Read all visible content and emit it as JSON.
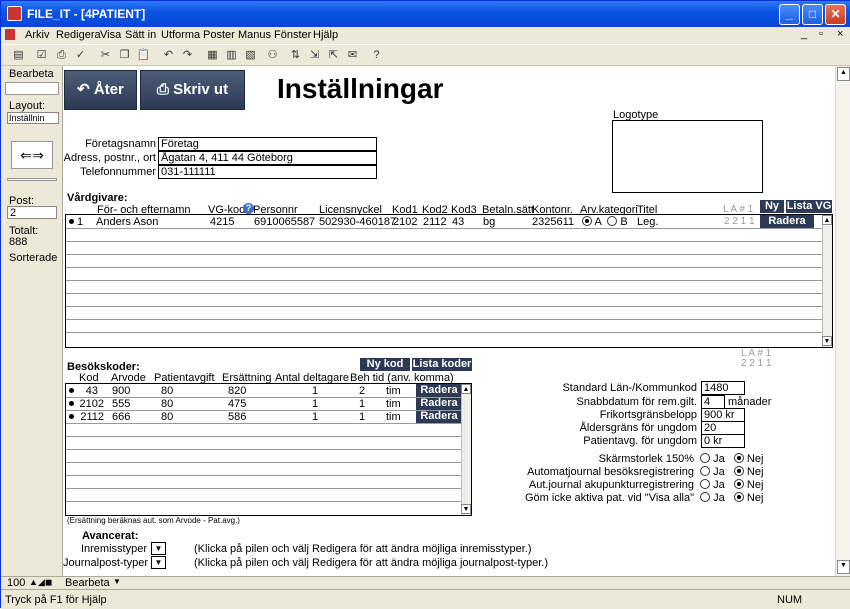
{
  "window": {
    "title": "FILE_IT - [4PATIENT]"
  },
  "menu": [
    "Arkiv",
    "Redigera",
    "Visa",
    "Sätt in",
    "Utforma",
    "Poster",
    "Manus",
    "Fönster",
    "Hjälp"
  ],
  "left": {
    "mode": "Bearbeta",
    "layout_label": "Layout:",
    "layout_value": "Inställnin",
    "post_label": "Post:",
    "post_value": "2",
    "total_label": "Totalt:",
    "total_value": "888",
    "sorted": "Sorterade"
  },
  "header": {
    "back": "Åter",
    "print": "Skriv ut",
    "title": "Inställningar",
    "logo_label": "Logotype"
  },
  "company": {
    "name_label": "Företagsnamn",
    "name": "Företag",
    "addr_label": "Adress, postnr., ort",
    "addr": "Ågatan 4, 411 44 Göteborg",
    "phone_label": "Telefonnummer",
    "phone": "031-111111"
  },
  "vg": {
    "heading": "Vårdgivare:",
    "cols": [
      "För- och efternamn",
      "VG-kod",
      "Personnr",
      "Licensnyckel",
      "Kod1",
      "Kod2",
      "Kod3",
      "Betaln.sätt",
      "Kontonr.",
      "Arv.kategori",
      "Titel"
    ],
    "new": "Ny",
    "list": "Lista VG",
    "delete": "Radera",
    "lahdr": "L A # 1",
    "laval": "2 2 1 1",
    "row": {
      "num": "1",
      "name": "Anders Ason",
      "code": "4215",
      "pnr": "6910065587",
      "lic": "502930-460187",
      "k1": "2102",
      "k2": "2112",
      "k3": "43",
      "pay": "bg",
      "acct": "2325611",
      "catA": "A",
      "catB": "B",
      "title": "Leg."
    }
  },
  "visit": {
    "heading": "Besökskoder:",
    "new": "Ny kod",
    "list": "Lista koder",
    "cols": [
      "Kod",
      "Arvode",
      "Patientavgift",
      "Ersättning",
      "Antal deltagare",
      "Beh tid (anv. komma)"
    ],
    "delete": "Radera",
    "rows": [
      {
        "code": "43",
        "fee": "900",
        "pfee": "80",
        "comp": "820",
        "n": "1",
        "time": "2",
        "unit": "tim"
      },
      {
        "code": "2102",
        "fee": "555",
        "pfee": "80",
        "comp": "475",
        "n": "1",
        "time": "1",
        "unit": "tim"
      },
      {
        "code": "2112",
        "fee": "666",
        "pfee": "80",
        "comp": "586",
        "n": "1",
        "time": "1",
        "unit": "tim"
      }
    ],
    "note": "(Ersättning beräknas aut. som Arvode - Pat.avg.)",
    "lahdr": "L A # 1",
    "laval": "2 2 1 1"
  },
  "settings": {
    "lan_label": "Standard Län-/Kommunkod",
    "lan": "1480",
    "snab_label": "Snabbdatum för rem.gilt.",
    "snab": "4",
    "snab_unit": "månader",
    "frik_label": "Frikortsgränsbelopp",
    "frik": "900 kr",
    "alder_label": "Åldersgräns för ungdom",
    "alder": "20",
    "pat_label": "Patientavg. för ungdom",
    "pat": "0 kr",
    "yes": "Ja",
    "no": "Nej",
    "toggles": [
      {
        "label": "Skärmstorlek 150%",
        "value": "Nej"
      },
      {
        "label": "Automatjournal besöksregistrering",
        "value": "Nej"
      },
      {
        "label": "Aut.journal akupunkturregistrering",
        "value": "Nej"
      },
      {
        "label": "Göm icke aktiva pat. vid \"Visa alla\"",
        "value": "Nej"
      }
    ]
  },
  "adv": {
    "heading": "Avancerat:",
    "inre_label": "Inremisstyper",
    "inre_hint": "(Klicka på pilen och välj Redigera för att ändra möjliga inremisstyper.)",
    "journ_label": "Journalpost-typer",
    "journ_hint": "(Klicka på pilen och välj Redigera för att ändra möjliga journalpost-typer.)"
  },
  "bottom": {
    "zoom": "100",
    "mode": "Bearbeta"
  },
  "status": {
    "help": "Tryck på F1 för Hjälp",
    "num": "NUM"
  }
}
